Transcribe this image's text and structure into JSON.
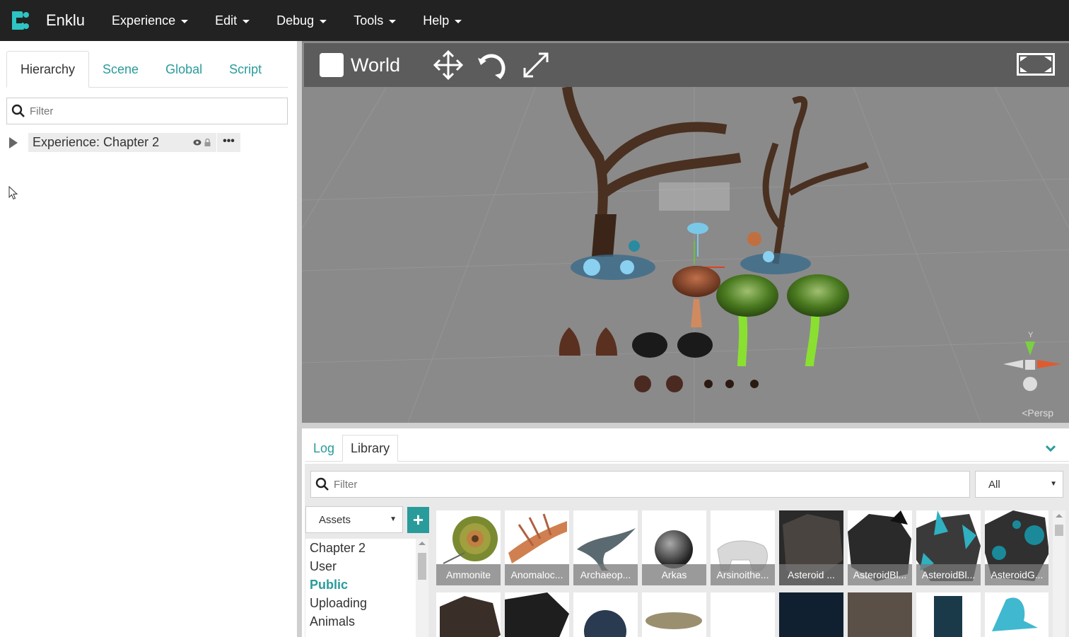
{
  "app": {
    "brand": "Enklu",
    "brand_color": "#2a9b9b"
  },
  "menu": [
    {
      "label": "Experience"
    },
    {
      "label": "Edit"
    },
    {
      "label": "Debug"
    },
    {
      "label": "Tools"
    },
    {
      "label": "Help"
    }
  ],
  "left_panel": {
    "tabs": [
      {
        "label": "Hierarchy",
        "active": true
      },
      {
        "label": "Scene",
        "active": false
      },
      {
        "label": "Global",
        "active": false
      },
      {
        "label": "Script",
        "active": false
      }
    ],
    "filter_placeholder": "Filter",
    "tree_root": {
      "label": "Experience: Chapter 2",
      "more": "•••"
    }
  },
  "viewport": {
    "space_label": "World",
    "camera_label": "Persp",
    "gizmo_axis_label": "Y",
    "tools": [
      "move-icon",
      "rotate-icon",
      "scale-icon"
    ]
  },
  "bottom_panel": {
    "tabs": [
      {
        "label": "Log",
        "active": false
      },
      {
        "label": "Library",
        "active": true
      }
    ],
    "filter_placeholder": "Filter",
    "type_select": "All",
    "source_select": "Assets",
    "add_label": "+",
    "categories": [
      {
        "label": "Chapter 2",
        "active": false
      },
      {
        "label": "User",
        "active": false
      },
      {
        "label": "Public",
        "active": true
      },
      {
        "label": "Uploading",
        "active": false
      },
      {
        "label": "Animals",
        "active": false
      }
    ],
    "assets_row1": [
      {
        "label": "Ammonite",
        "bg": "#ffffff"
      },
      {
        "label": "Anomaloc...",
        "bg": "#ffffff"
      },
      {
        "label": "Archaeop...",
        "bg": "#ffffff"
      },
      {
        "label": "Arkas",
        "bg": "#ffffff"
      },
      {
        "label": "Arsinoithe...",
        "bg": "#ffffff"
      },
      {
        "label": "Asteroid ...",
        "bg": "#2a2a2a"
      },
      {
        "label": "AsteroidBl...",
        "bg": "#ffffff"
      },
      {
        "label": "AsteroidBl...",
        "bg": "#ffffff"
      },
      {
        "label": "AsteroidG...",
        "bg": "#ffffff"
      }
    ]
  }
}
